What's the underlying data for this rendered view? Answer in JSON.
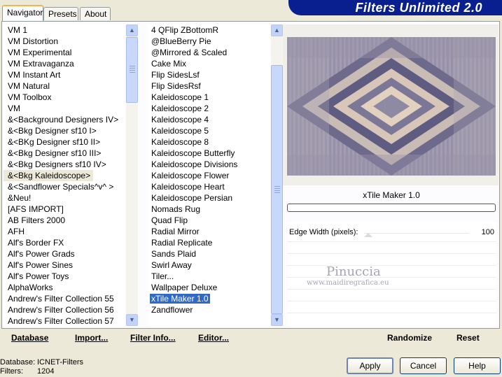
{
  "app": {
    "title": "Filters Unlimited 2.0"
  },
  "tabs": [
    {
      "label": "Navigator"
    },
    {
      "label": "Presets"
    },
    {
      "label": "About"
    }
  ],
  "categories": [
    "VM 1",
    "VM Distortion",
    "VM Experimental",
    "VM Extravaganza",
    "VM Instant Art",
    "VM Natural",
    "VM Toolbox",
    "VM",
    "&<Background Designers IV>",
    "&<Bkg Designer sf10 I>",
    "&<BKg Designer sf10 II>",
    "&<Bkg Designer sf10 III>",
    "&<Bkg Designers sf10 IV>",
    "&<Bkg Kaleidoscope>",
    "&<Sandflower Specials^v^ >",
    "&Neu!",
    "[AFS IMPORT]",
    "AB Filters 2000",
    "AFH",
    "Alf's Border FX",
    "Alf's Power Grads",
    "Alf's Power Sines",
    "Alf's Power Toys",
    "AlphaWorks",
    "Andrew's Filter Collection 55",
    "Andrew's Filter Collection 56",
    "Andrew's Filter Collection 57"
  ],
  "filters": [
    "4 QFlip ZBottomR",
    "@BlueBerry Pie",
    "@Mirrored & Scaled",
    "Cake Mix",
    "Flip SidesLsf",
    "Flip SidesRsf",
    "Kaleidoscope 1",
    "Kaleidoscope 2",
    "Kaleidoscope 4",
    "Kaleidoscope 5",
    "Kaleidoscope 8",
    "Kaleidoscope Butterfly",
    "Kaleidoscope Divisions",
    "Kaleidoscope Flower",
    "Kaleidoscope Heart",
    "Kaleidoscope Persian",
    "Nomads Rug",
    "Quad Flip",
    "Radial Mirror",
    "Radial Replicate",
    "Sands Plaid",
    "Swirl Away",
    "Tiler...",
    "Wallpaper Deluxe",
    "xTile Maker 1.0",
    "Zandflower"
  ],
  "selected_category_index": 13,
  "selected_filter_index": 24,
  "preview": {
    "filter_name": "xTile Maker 1.0",
    "progress": 0
  },
  "params": [
    {
      "label": "Edge Width (pixels):",
      "value": "100"
    }
  ],
  "watermark": {
    "name": "Pinuccia",
    "url": "www.maidiregrafica.eu"
  },
  "links": {
    "database": "Database",
    "import": "Import...",
    "filter_info": "Filter Info...",
    "editor": "Editor...",
    "randomize": "Randomize",
    "reset": "Reset"
  },
  "buttons": {
    "apply": "Apply",
    "cancel": "Cancel",
    "help": "Help"
  },
  "status": {
    "database_label": "Database:",
    "database_value": "ICNET-Filters",
    "filters_label": "Filters:",
    "filters_value": "1204"
  },
  "colors": {
    "title_bar": "#0a1f8f",
    "selection": "#316ac5",
    "panel": "#fcfcfe"
  }
}
